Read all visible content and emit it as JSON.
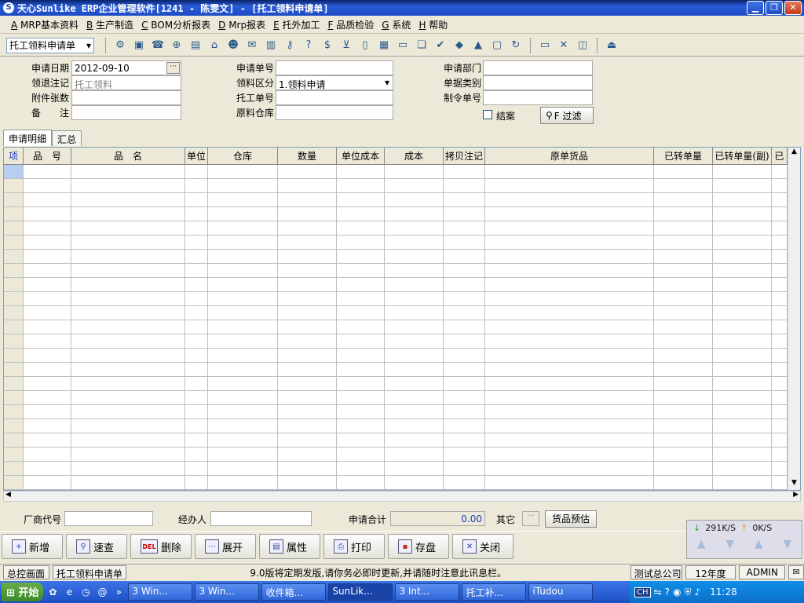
{
  "title": "天心Sunlike ERP企业管理软件[1241 - 陈雯文] - [托工领料申请单]",
  "menus": [
    {
      "key": "A",
      "label": "MRP基本资料"
    },
    {
      "key": "B",
      "label": "生产制造"
    },
    {
      "key": "C",
      "label": "BOM分析报表"
    },
    {
      "key": "D",
      "label": "Mrp报表"
    },
    {
      "key": "E",
      "label": "托外加工"
    },
    {
      "key": "F",
      "label": "品质检验"
    },
    {
      "key": "G",
      "label": "系统"
    },
    {
      "key": "H",
      "label": "帮助"
    }
  ],
  "toolbar": {
    "combo_value": "托工领料申请单"
  },
  "form": {
    "apply_date_label": "申请日期",
    "apply_date": "2012-09-10",
    "return_label": "领退注记",
    "return_value": "托工领料",
    "attach_label": "附件张数",
    "attach_value": "",
    "remark_label": "备　　注",
    "remark_value": "",
    "apply_no_label": "申请单号",
    "apply_no": "",
    "pick_type_label": "领料区分",
    "pick_type": "1.领料申请",
    "work_no_label": "托工单号",
    "work_no": "",
    "warehouse_label": "原料仓库",
    "warehouse": "",
    "dept_label": "申请部门",
    "dept": "",
    "doc_type_label": "单据类别",
    "doc_type": "",
    "order_no_label": "制令单号",
    "order_no": "",
    "close_label": "结案",
    "filter_label": "F 过滤"
  },
  "tabs": [
    {
      "label": "申请明细"
    },
    {
      "label": "汇总"
    }
  ],
  "grid": {
    "columns": [
      "项",
      "品　号",
      "品　名",
      "单位",
      "仓库",
      "数量",
      "单位成本",
      "成本",
      "拷贝注记",
      "原单货品",
      "已转单量",
      "已转单量(副)",
      "已"
    ]
  },
  "bottom": {
    "vendor_label": "厂商代号",
    "vendor": "",
    "handler_label": "经办人",
    "handler": "",
    "total_label": "申请合计",
    "total": "0.00",
    "other_label": "其它",
    "estimate_label": "货品预估"
  },
  "buttons": [
    {
      "label": "新增"
    },
    {
      "label": "速查"
    },
    {
      "label": "删除"
    },
    {
      "label": "展开"
    },
    {
      "label": "属性"
    },
    {
      "label": "打印"
    },
    {
      "label": "存盘"
    },
    {
      "label": "关闭"
    }
  ],
  "netspeed": {
    "down": "291K/S",
    "up": "0K/S"
  },
  "status": {
    "panel1": "总控画面",
    "panel2": "托工领料申请单",
    "message": "9.0版将定期发版,请你务必即时更新,并请随时注意此讯息栏。",
    "company": "测试总公司",
    "year": "12年度",
    "user": "ADMIN"
  },
  "taskbar": {
    "start": "开始",
    "tasks": [
      "3 Win...",
      "3 Win...",
      "收件箱...",
      "SunLik...",
      "3 Int...",
      "托工补...",
      "iTudou"
    ],
    "lang": "CH",
    "time": "11:28"
  }
}
